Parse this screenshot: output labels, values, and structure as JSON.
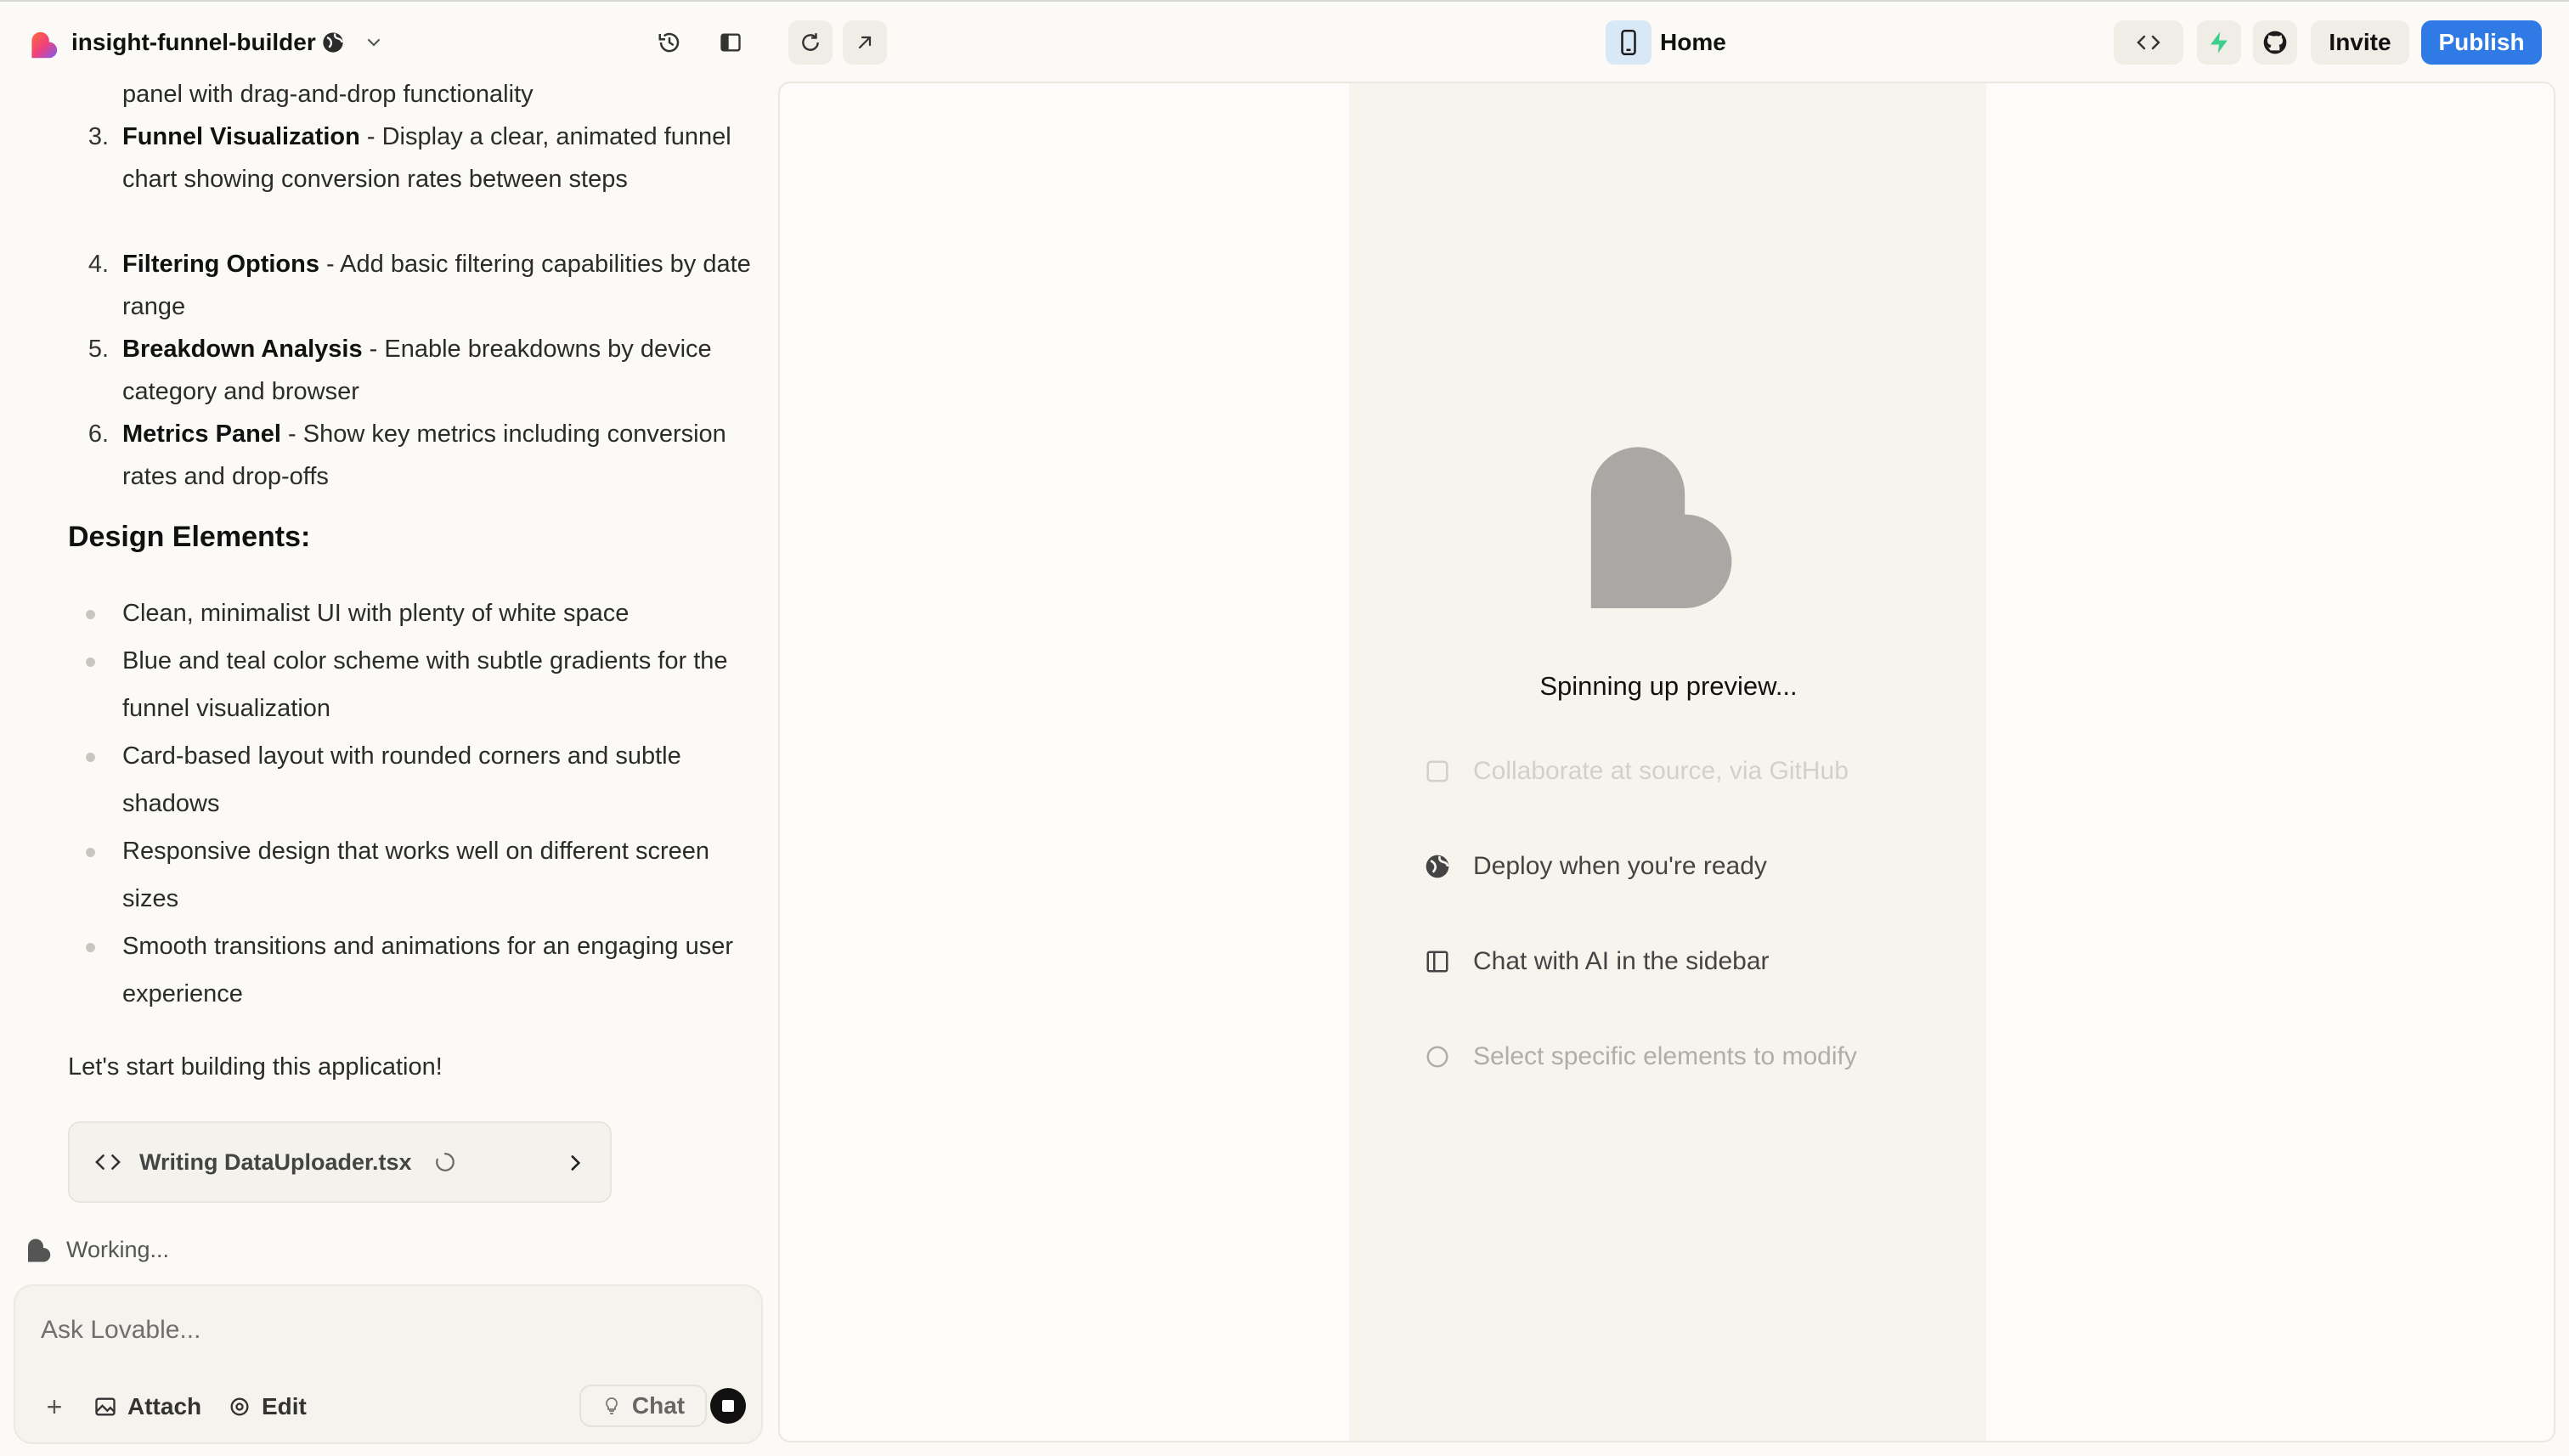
{
  "header": {
    "project_name": "insight-funnel-builder",
    "route": "Home",
    "invite_label": "Invite",
    "publish_label": "Publish"
  },
  "chat": {
    "numbered_items": [
      {
        "number": "",
        "title": "",
        "text": "panel with drag-and-drop functionality"
      },
      {
        "number": "3.",
        "title": "Funnel Visualization",
        "text": " - Display a clear, animated funnel chart showing conversion rates between steps"
      },
      {
        "number": "4.",
        "title": "Filtering Options",
        "text": " - Add basic filtering capabilities by date range"
      },
      {
        "number": "5.",
        "title": "Breakdown Analysis",
        "text": " - Enable breakdowns by device category and browser"
      },
      {
        "number": "6.",
        "title": "Metrics Panel",
        "text": " - Show key metrics including conversion rates and drop-offs"
      }
    ],
    "design_heading": "Design Elements:",
    "design_items": [
      "Clean, minimalist UI with plenty of white space",
      "Blue and teal color scheme with subtle gradients for the funnel visualization",
      "Card-based layout with rounded corners and subtle shadows",
      "Responsive design that works well on different screen sizes",
      "Smooth transitions and animations for an engaging user experience"
    ],
    "closing": "Let's start building this application!",
    "file_card_label": "Writing DataUploader.tsx",
    "status": "Working..."
  },
  "composer": {
    "placeholder": "Ask Lovable...",
    "attach_label": "Attach",
    "edit_label": "Edit",
    "chat_label": "Chat"
  },
  "preview": {
    "loading_text": "Spinning up preview...",
    "features": [
      {
        "icon": "github-outline-icon",
        "text": "Collaborate at source, via GitHub"
      },
      {
        "icon": "globe-icon",
        "text": "Deploy when you're ready"
      },
      {
        "icon": "sidebar-icon",
        "text": "Chat with AI in the sidebar"
      },
      {
        "icon": "circle-icon",
        "text": "Select specific elements to modify"
      }
    ]
  },
  "colors": {
    "accent": "#2f7ae5",
    "background": "#fbfaf7",
    "supabase": "#3ecf8e",
    "loader_heart": "#aaa8a4"
  }
}
